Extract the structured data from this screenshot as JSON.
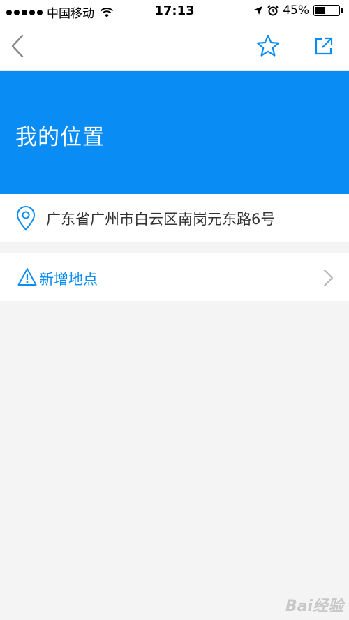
{
  "status_bar": {
    "carrier": "中国移动",
    "time": "17:13",
    "battery_percent": "45%",
    "battery_level": 0.45,
    "icons": [
      "signal-dots-icon",
      "wifi-icon",
      "location-arrow-icon",
      "alarm-icon",
      "battery-icon"
    ]
  },
  "nav": {
    "icons": [
      "back-chevron-icon",
      "star-icon",
      "share-icon"
    ]
  },
  "hero": {
    "title": "我的位置",
    "background": "#0a8cf5"
  },
  "location": {
    "address": "广东省广州市白云区南岗元东路6号",
    "icon": "location-pin-icon"
  },
  "add_place": {
    "label": "新增地点",
    "icon": "warning-triangle-icon",
    "accent": "#0a8cf5"
  },
  "watermark": {
    "text": "Bai经验"
  }
}
